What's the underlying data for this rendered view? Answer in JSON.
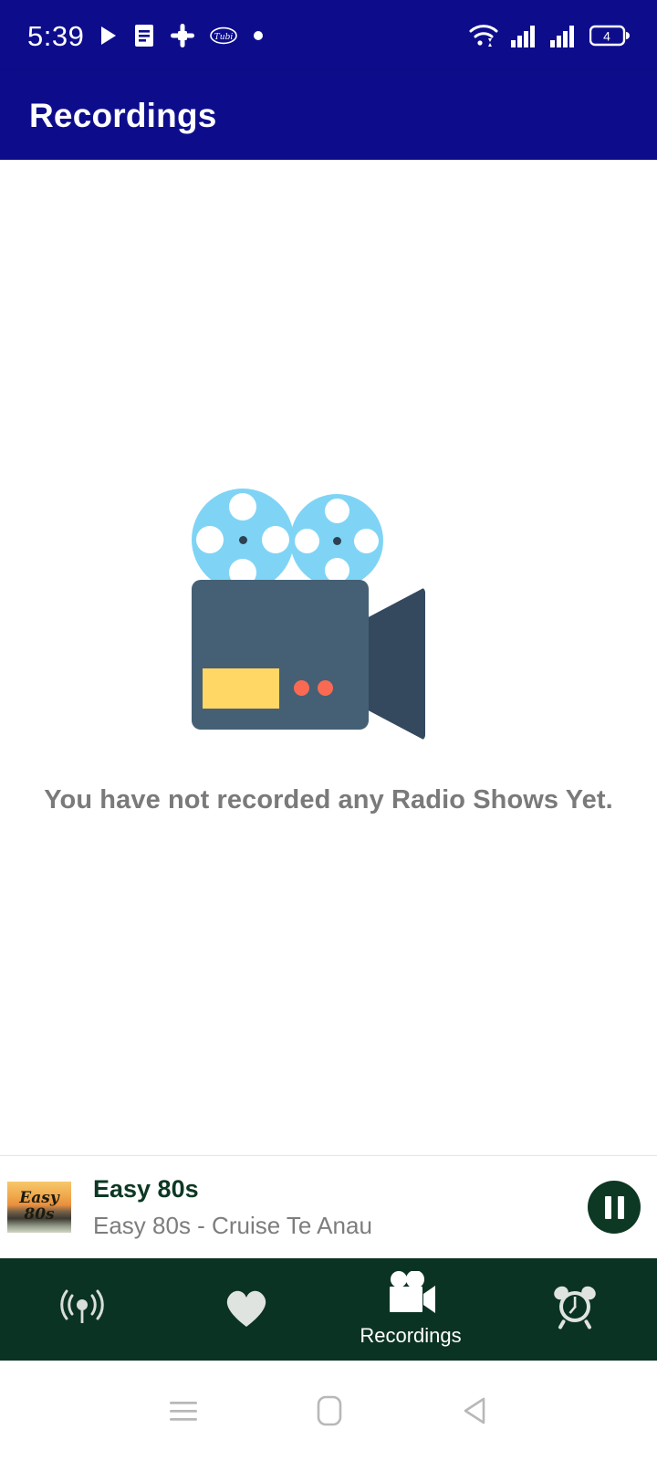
{
  "status_bar": {
    "time": "5:39",
    "left_icons": [
      "play-icon",
      "list-document-icon",
      "slack-icon",
      "oval-logo-icon",
      "dot-icon"
    ],
    "right_icons": [
      "wifi-icon",
      "signal-bars-icon-1",
      "signal-bars-icon-2",
      "battery-icon"
    ],
    "battery_level": "4",
    "background_color": "#0d0d8c"
  },
  "header": {
    "title": "Recordings",
    "background_color": "#0d0d8c",
    "text_color": "#ffffff"
  },
  "main": {
    "empty_state": {
      "message": "You have not recorded any Radio Shows Yet.",
      "illustration": "movie-camera-illustration",
      "illustration_colors": {
        "reel": "#7fd4f5",
        "body": "#456074",
        "lens": "#34495e",
        "screen": "#ffd765",
        "buttons": "#fa6a52"
      },
      "text_color": "#7a7a7a"
    }
  },
  "mini_player": {
    "station_title": "Easy 80s",
    "now_playing": "Easy 80s - Cruise Te Anau",
    "thumbnail_text_line1": "Easy",
    "thumbnail_text_line2": "80s",
    "play_state_icon": "pause-icon",
    "button_color": "#0d3823",
    "title_color": "#0d3823"
  },
  "bottom_nav": {
    "background_color": "#0b3323",
    "items": [
      {
        "label": "",
        "icon": "radio-broadcast-icon",
        "active": false
      },
      {
        "label": "",
        "icon": "heart-icon",
        "active": false
      },
      {
        "label": "Recordings",
        "icon": "video-camera-icon",
        "active": true
      },
      {
        "label": "",
        "icon": "alarm-clock-icon",
        "active": false
      }
    ]
  },
  "system_nav": {
    "buttons": [
      "recents-icon",
      "home-icon",
      "back-icon"
    ]
  }
}
